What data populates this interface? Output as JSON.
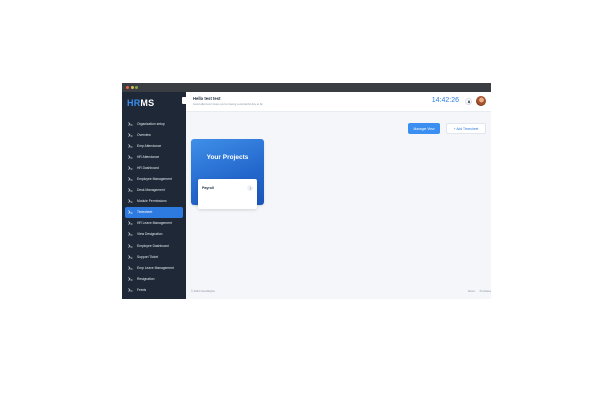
{
  "app": {
    "logo_hr": "HR",
    "logo_ms": "MS"
  },
  "sidebar": {
    "items": [
      {
        "label": "Organization setup",
        "icon": "settings-icon",
        "active": false
      },
      {
        "label": "Overview",
        "icon": "overview-icon",
        "active": false
      },
      {
        "label": "Emp Attendance",
        "icon": "attendance-icon",
        "active": false
      },
      {
        "label": "HR Attendance",
        "icon": "attendance-icon",
        "active": false
      },
      {
        "label": "HR Dashboard",
        "icon": "dashboard-icon",
        "active": false
      },
      {
        "label": "Employee Management",
        "icon": "employee-icon",
        "active": false
      },
      {
        "label": "Desk Management",
        "icon": "desk-icon",
        "active": false
      },
      {
        "label": "Module Permissions",
        "icon": "permissions-icon",
        "active": false
      },
      {
        "label": "Timesheet",
        "icon": "timesheet-icon",
        "active": true
      },
      {
        "label": "HR Leave Management",
        "icon": "leave-icon",
        "active": false
      },
      {
        "label": "View Designation",
        "icon": "designation-icon",
        "active": false
      },
      {
        "label": "Employee Dashboard",
        "icon": "dashboard-icon",
        "active": false
      },
      {
        "label": "Support Ticket",
        "icon": "ticket-icon",
        "active": false
      },
      {
        "label": "Emp Leave Management",
        "icon": "leave-icon",
        "active": false
      },
      {
        "label": "Resignation",
        "icon": "resignation-icon",
        "active": false
      },
      {
        "label": "Feeds",
        "icon": "feeds-icon",
        "active": false
      }
    ]
  },
  "header": {
    "greeting": "Hello test test",
    "subtitle": "Good afternoon! Hope you're having a wonderful day at Itp",
    "clock": "14:42:26"
  },
  "actions": {
    "manager_view": "Manager View",
    "add_timesheet": "+ Add Timesheet"
  },
  "project_card": {
    "title": "Your Projects",
    "project_name": "Payroll"
  },
  "footer": {
    "copyright": "© 2024 CloudStyles",
    "about": "About",
    "purchase": "Purchase"
  },
  "colors": {
    "accent": "#2d7be0",
    "sidebar_bg": "#1e2836",
    "card_gradient": "#2367cc"
  }
}
